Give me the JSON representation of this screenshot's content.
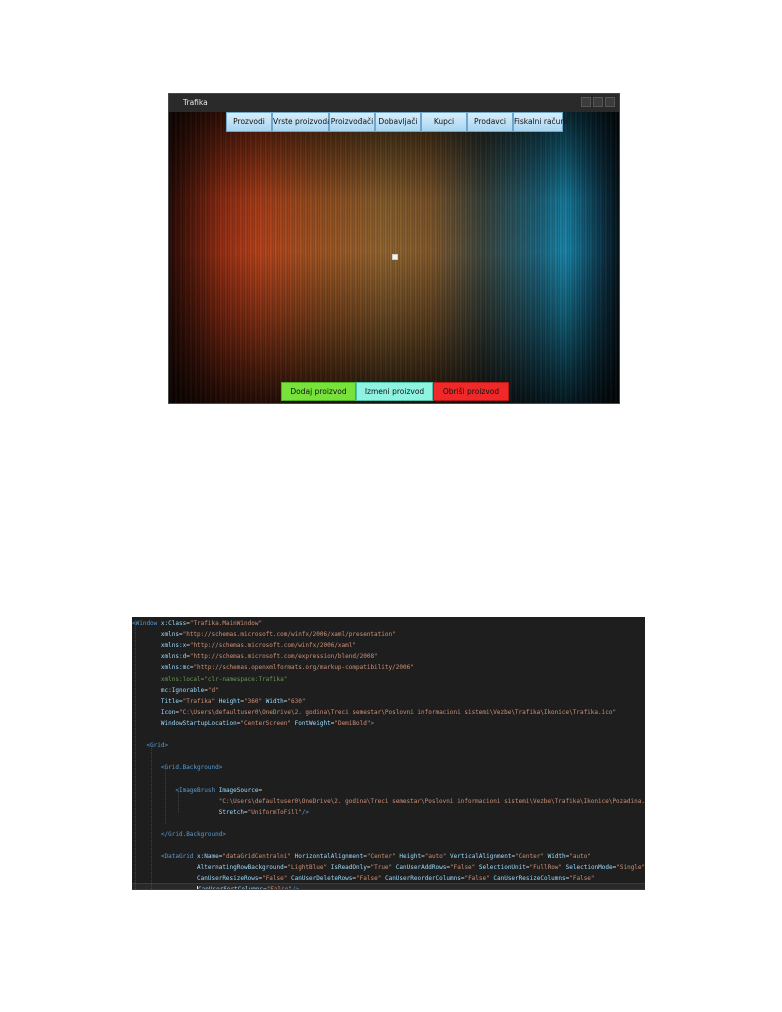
{
  "window": {
    "title": "Trafika",
    "menu_buttons": [
      "Prozvodi",
      "Vrste proizvoda",
      "Proizvođači",
      "Dobavljači",
      "Kupci",
      "Prodavci",
      "Fiskalni računi"
    ],
    "bottom_buttons": {
      "add": "Dodaj proizvod",
      "edit": "Izmeni proizvod",
      "delete": "Obriši proizvod"
    },
    "colors": {
      "add": "#77e23c",
      "edit": "#8ff3e2",
      "delete": "#f12828",
      "menu": "#a7d5f1"
    }
  },
  "editor": {
    "lines": [
      [
        {
          "c": "t-tag",
          "t": "<Window "
        },
        {
          "c": "t-attr",
          "t": "x:Class"
        },
        {
          "c": "t-plain",
          "t": "="
        },
        {
          "c": "t-str",
          "t": "\"Trafika.MainWindow\""
        }
      ],
      [
        {
          "c": "t-plain",
          "t": "        "
        },
        {
          "c": "t-attr",
          "t": "xmlns"
        },
        {
          "c": "t-plain",
          "t": "="
        },
        {
          "c": "t-str",
          "t": "\"http://schemas.microsoft.com/winfx/2006/xaml/presentation\""
        }
      ],
      [
        {
          "c": "t-plain",
          "t": "        "
        },
        {
          "c": "t-attr",
          "t": "xmlns:x"
        },
        {
          "c": "t-plain",
          "t": "="
        },
        {
          "c": "t-str",
          "t": "\"http://schemas.microsoft.com/winfx/2006/xaml\""
        }
      ],
      [
        {
          "c": "t-plain",
          "t": "        "
        },
        {
          "c": "t-attr",
          "t": "xmlns:d"
        },
        {
          "c": "t-plain",
          "t": "="
        },
        {
          "c": "t-str",
          "t": "\"http://schemas.microsoft.com/expression/blend/2008\""
        }
      ],
      [
        {
          "c": "t-plain",
          "t": "        "
        },
        {
          "c": "t-attr",
          "t": "xmlns:mc"
        },
        {
          "c": "t-plain",
          "t": "="
        },
        {
          "c": "t-str",
          "t": "\"http://schemas.openxmlformats.org/markup-compatibility/2006\""
        }
      ],
      [
        {
          "c": "t-plain",
          "t": "        "
        },
        {
          "c": "t-comment-ish",
          "t": "xmlns:local=\"clr-namespace:Trafika\""
        }
      ],
      [
        {
          "c": "t-plain",
          "t": "        "
        },
        {
          "c": "t-attr",
          "t": "mc:Ignorable"
        },
        {
          "c": "t-plain",
          "t": "="
        },
        {
          "c": "t-str",
          "t": "\"d\""
        }
      ],
      [
        {
          "c": "t-plain",
          "t": "        "
        },
        {
          "c": "t-attr",
          "t": "Title"
        },
        {
          "c": "t-plain",
          "t": "="
        },
        {
          "c": "t-str",
          "t": "\"Trafika\""
        },
        {
          "c": "t-plain",
          "t": " "
        },
        {
          "c": "t-attr",
          "t": "Height"
        },
        {
          "c": "t-plain",
          "t": "="
        },
        {
          "c": "t-str",
          "t": "\"360\""
        },
        {
          "c": "t-plain",
          "t": " "
        },
        {
          "c": "t-attr",
          "t": "Width"
        },
        {
          "c": "t-plain",
          "t": "="
        },
        {
          "c": "t-str",
          "t": "\"630\""
        }
      ],
      [
        {
          "c": "t-plain",
          "t": "        "
        },
        {
          "c": "t-attr",
          "t": "Icon"
        },
        {
          "c": "t-plain",
          "t": "="
        },
        {
          "c": "t-str",
          "t": "\"C:\\Users\\defaultuser0\\OneDrive\\2. godina\\Treci semestar\\Poslovni informacioni sistemi\\Vezbe\\Trafika\\Ikonice\\Trafika.ico\""
        }
      ],
      [
        {
          "c": "t-plain",
          "t": "        "
        },
        {
          "c": "t-attr",
          "t": "WindowStartupLocation"
        },
        {
          "c": "t-plain",
          "t": "="
        },
        {
          "c": "t-str",
          "t": "\"CenterScreen\""
        },
        {
          "c": "t-plain",
          "t": " "
        },
        {
          "c": "t-attr",
          "t": "FontWeight"
        },
        {
          "c": "t-plain",
          "t": "="
        },
        {
          "c": "t-str",
          "t": "\"DemiBold\""
        },
        {
          "c": "t-tag",
          "t": ">"
        }
      ],
      [],
      [
        {
          "c": "t-plain",
          "t": "    "
        },
        {
          "c": "t-tag",
          "t": "<Grid>"
        }
      ],
      [],
      [
        {
          "c": "t-plain",
          "t": "        "
        },
        {
          "c": "t-tag",
          "t": "<Grid.Background>"
        }
      ],
      [],
      [
        {
          "c": "t-plain",
          "t": "            "
        },
        {
          "c": "t-tag",
          "t": "<ImageBrush "
        },
        {
          "c": "t-attr",
          "t": "ImageSource"
        },
        {
          "c": "t-plain",
          "t": "="
        }
      ],
      [
        {
          "c": "t-plain",
          "t": "                        "
        },
        {
          "c": "t-str",
          "t": "\"C:\\Users\\defaultuser0\\OneDrive\\2. godina\\Treci semestar\\Poslovni informacioni sistemi\\Vezbe\\Trafika\\Ikonice\\Pozadina.png\""
        }
      ],
      [
        {
          "c": "t-plain",
          "t": "                        "
        },
        {
          "c": "t-attr",
          "t": "Stretch"
        },
        {
          "c": "t-plain",
          "t": "="
        },
        {
          "c": "t-str",
          "t": "\"UniformToFill\""
        },
        {
          "c": "t-tag",
          "t": "/>"
        }
      ],
      [],
      [
        {
          "c": "t-plain",
          "t": "        "
        },
        {
          "c": "t-tag",
          "t": "</Grid.Background>"
        }
      ],
      [],
      [
        {
          "c": "t-plain",
          "t": "        "
        },
        {
          "c": "t-tag",
          "t": "<DataGrid "
        },
        {
          "c": "t-attr",
          "t": "x:Name"
        },
        {
          "c": "t-plain",
          "t": "="
        },
        {
          "c": "t-str",
          "t": "\"dataGridCentralni\""
        },
        {
          "c": "t-plain",
          "t": " "
        },
        {
          "c": "t-attr",
          "t": "HorizontalAlignment"
        },
        {
          "c": "t-plain",
          "t": "="
        },
        {
          "c": "t-str",
          "t": "\"Center\""
        },
        {
          "c": "t-plain",
          "t": " "
        },
        {
          "c": "t-attr",
          "t": "Height"
        },
        {
          "c": "t-plain",
          "t": "="
        },
        {
          "c": "t-str",
          "t": "\"auto\""
        },
        {
          "c": "t-plain",
          "t": " "
        },
        {
          "c": "t-attr",
          "t": "VerticalAlignment"
        },
        {
          "c": "t-plain",
          "t": "="
        },
        {
          "c": "t-str",
          "t": "\"Center\""
        },
        {
          "c": "t-plain",
          "t": " "
        },
        {
          "c": "t-attr",
          "t": "Width"
        },
        {
          "c": "t-plain",
          "t": "="
        },
        {
          "c": "t-str",
          "t": "\"auto\""
        }
      ],
      [
        {
          "c": "t-plain",
          "t": "                  "
        },
        {
          "c": "t-attr",
          "t": "AlternatingRowBackground"
        },
        {
          "c": "t-plain",
          "t": "="
        },
        {
          "c": "t-str",
          "t": "\"LightBlue\""
        },
        {
          "c": "t-plain",
          "t": " "
        },
        {
          "c": "t-attr",
          "t": "IsReadOnly"
        },
        {
          "c": "t-plain",
          "t": "="
        },
        {
          "c": "t-str",
          "t": "\"True\""
        },
        {
          "c": "t-plain",
          "t": " "
        },
        {
          "c": "t-attr",
          "t": "CanUserAddRows"
        },
        {
          "c": "t-plain",
          "t": "="
        },
        {
          "c": "t-str",
          "t": "\"False\""
        },
        {
          "c": "t-plain",
          "t": " "
        },
        {
          "c": "t-attr",
          "t": "SelectionUnit"
        },
        {
          "c": "t-plain",
          "t": "="
        },
        {
          "c": "t-str",
          "t": "\"FullRow\""
        },
        {
          "c": "t-plain",
          "t": " "
        },
        {
          "c": "t-attr",
          "t": "SelectionMode"
        },
        {
          "c": "t-plain",
          "t": "="
        },
        {
          "c": "t-str",
          "t": "\"Single\""
        }
      ],
      [
        {
          "c": "t-plain",
          "t": "                  "
        },
        {
          "c": "t-attr",
          "t": "CanUserResizeRows"
        },
        {
          "c": "t-plain",
          "t": "="
        },
        {
          "c": "t-str",
          "t": "\"False\""
        },
        {
          "c": "t-plain",
          "t": " "
        },
        {
          "c": "t-attr",
          "t": "CanUserDeleteRows"
        },
        {
          "c": "t-plain",
          "t": "="
        },
        {
          "c": "t-str",
          "t": "\"False\""
        },
        {
          "c": "t-plain",
          "t": " "
        },
        {
          "c": "t-attr",
          "t": "CanUserReorderColumns"
        },
        {
          "c": "t-plain",
          "t": "="
        },
        {
          "c": "t-str",
          "t": "\"False\""
        },
        {
          "c": "t-plain",
          "t": " "
        },
        {
          "c": "t-attr",
          "t": "CanUserResizeColumns"
        },
        {
          "c": "t-plain",
          "t": "="
        },
        {
          "c": "t-str",
          "t": "\"False\""
        }
      ],
      [
        {
          "c": "t-plain",
          "t": "                  "
        },
        {
          "c": "caret",
          "t": ""
        },
        {
          "c": "t-attr",
          "t": "CanUserSortColumns"
        },
        {
          "c": "t-plain",
          "t": "="
        },
        {
          "c": "t-str",
          "t": "\"False\""
        },
        {
          "c": "t-tag",
          "t": "/>"
        }
      ]
    ]
  }
}
